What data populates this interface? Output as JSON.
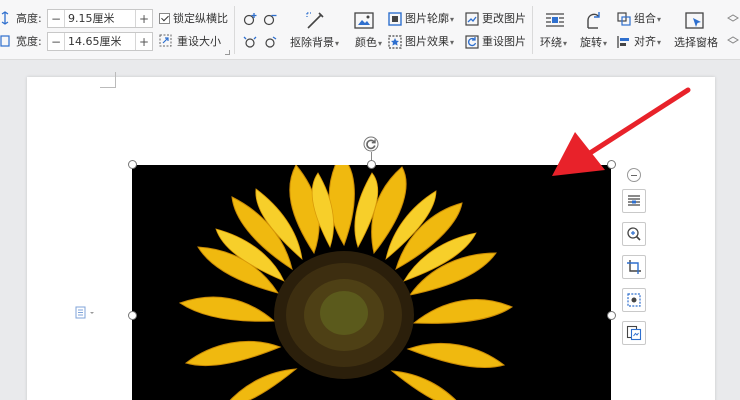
{
  "ribbon": {
    "size": {
      "height_label": "高度:",
      "height_value": "9.15厘米",
      "width_label": "宽度:",
      "width_value": "14.65厘米",
      "minus": "−",
      "plus": "+",
      "lock_ratio_label": "锁定纵横比",
      "lock_ratio_checked": true,
      "reset_size_label": "重设大小"
    },
    "remove_bg_label": "抠除背景",
    "color_label": "颜色",
    "picture_outline_label": "图片轮廓",
    "picture_effect_label": "图片效果",
    "change_picture_label": "更改图片",
    "reset_picture_label": "重设图片",
    "wrap_label": "环绕",
    "rotate_label": "旋转",
    "group_label": "组合",
    "align_label": "对齐",
    "selection_pane_label": "选择窗格",
    "dropdown_caret": "▾"
  },
  "colors": {
    "accent_blue": "#2e6fce",
    "arrow_red": "#e8222a",
    "sunflower_yellow": "#f5c517",
    "background_black": "#000000"
  },
  "icons": {
    "side_tools": [
      "layout-options-icon",
      "zoom-in-icon",
      "crop-icon",
      "picture-edit-icon",
      "compress-picture-icon"
    ]
  }
}
